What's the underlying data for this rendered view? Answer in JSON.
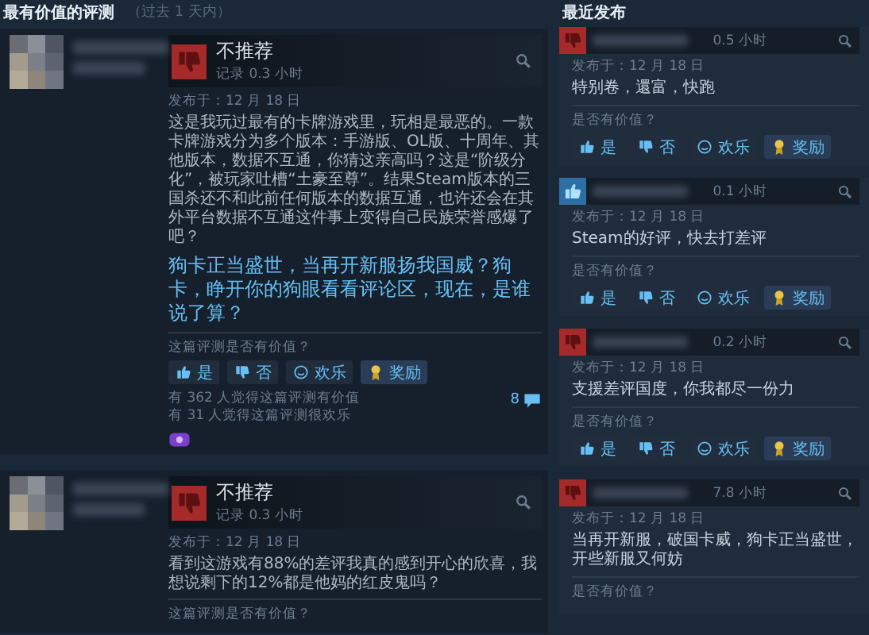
{
  "most_helpful": {
    "title": "最有价值的评测",
    "period": "（过去 1 天内）",
    "reviews": [
      {
        "verdict": "不推荐",
        "recommended": false,
        "hours": "记录 0.3 小时",
        "posted": "发布于：12 月 18 日",
        "body": "这是我玩过最有的卡牌游戏里，玩相是最恶的。一款卡牌游戏分为多个版本：手游版、OL版、十周年、其他版本，数据不互通，你猜这亲高吗？这是“阶级分化”，被玩家吐槽“土豪至尊”。结果Steam版本的三国杀还不和此前任何版本的数据互通，也许还会在其外平台数据不互通这件事上变得自己民族荣誉感爆了吧？",
        "highlight": "狗卡正当盛世，当再开新服扬我国威？狗卡，睁开你的狗眼看看评论区，现在，是谁说了算？",
        "helpful_prompt": "这篇评测是否有价值？",
        "votes": [
          {
            "label": "是",
            "kind": "yes"
          },
          {
            "label": "否",
            "kind": "no"
          },
          {
            "label": "欢乐",
            "kind": "funny"
          },
          {
            "label": "奖励",
            "kind": "award"
          }
        ],
        "stats": [
          "有 362 人觉得这篇评测有价值",
          "有 31 人觉得这篇评测很欢乐"
        ],
        "comments": "8",
        "award": true
      },
      {
        "verdict": "不推荐",
        "recommended": false,
        "hours": "记录 0.3 小时",
        "posted": "发布于：12 月 18 日",
        "body": "看到这游戏有88%的差评我真的感到开心的欣喜，我想说剩下的12%都是他妈的红皮鬼吗？",
        "helpful_prompt": "这篇评测是否有价值？"
      }
    ]
  },
  "recent": {
    "title": "最近发布",
    "reviews": [
      {
        "recommended": false,
        "hours": "0.5 小时",
        "posted": "发布于：12 月 18 日",
        "body": "特别卷，還富，快跑",
        "helpful_prompt": "是否有价值？",
        "votes": [
          {
            "label": "是",
            "kind": "yes"
          },
          {
            "label": "否",
            "kind": "no"
          },
          {
            "label": "欢乐",
            "kind": "funny"
          },
          {
            "label": "奖励",
            "kind": "award"
          }
        ]
      },
      {
        "recommended": true,
        "hours": "0.1 小时",
        "posted": "发布于：12 月 18 日",
        "body": "Steam的好评，快去打差评",
        "helpful_prompt": "是否有价值？",
        "votes": [
          {
            "label": "是",
            "kind": "yes"
          },
          {
            "label": "否",
            "kind": "no"
          },
          {
            "label": "欢乐",
            "kind": "funny"
          },
          {
            "label": "奖励",
            "kind": "award"
          }
        ]
      },
      {
        "recommended": false,
        "hours": "0.2 小时",
        "posted": "发布于：12 月 18 日",
        "body": "支援差评国度，你我都尽一份力",
        "helpful_prompt": "是否有价值？",
        "votes": [
          {
            "label": "是",
            "kind": "yes"
          },
          {
            "label": "否",
            "kind": "no"
          },
          {
            "label": "欢乐",
            "kind": "funny"
          },
          {
            "label": "奖励",
            "kind": "award"
          }
        ]
      },
      {
        "recommended": false,
        "hours": "7.8 小时",
        "posted": "发布于：12 月 18 日",
        "body": "当再开新服，破国卡威，狗卡正当盛世，开些新服又何妨",
        "helpful_prompt": "是否有价值？"
      }
    ]
  }
}
